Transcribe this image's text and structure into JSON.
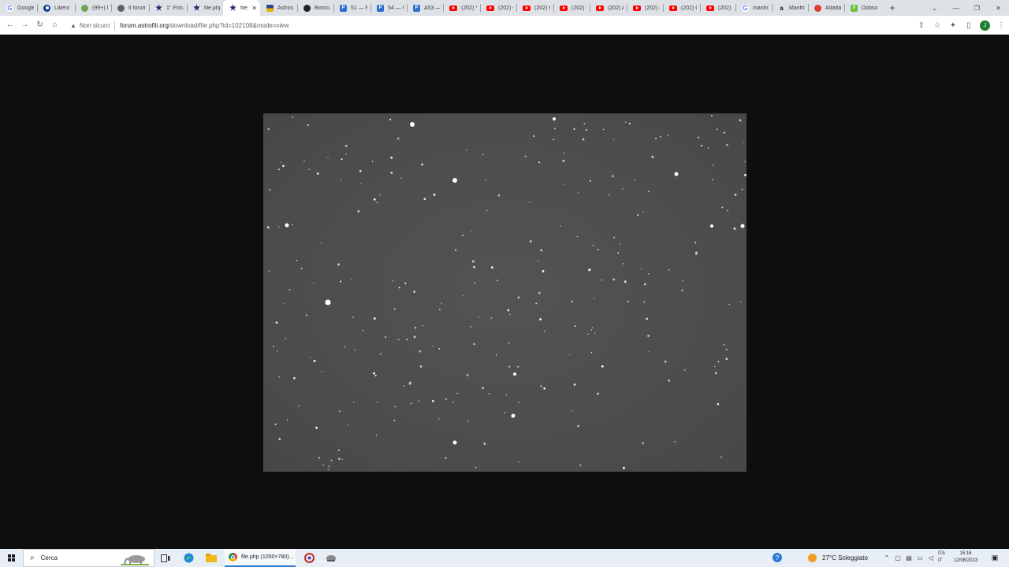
{
  "browser": {
    "tabs": [
      {
        "title": "Google",
        "icon": "google-icon",
        "active": false
      },
      {
        "title": "Libero",
        "icon": "libero-icon",
        "active": false
      },
      {
        "title": "(99+) M",
        "icon": "leaf-icon",
        "active": false
      },
      {
        "title": "Il forum",
        "icon": "globe-icon",
        "active": false
      },
      {
        "title": "1° Foru",
        "icon": "astrofili-star-icon",
        "active": false
      },
      {
        "title": "file.php",
        "icon": "astrofili-star-icon",
        "active": false
      },
      {
        "title": "file.",
        "icon": "astrofili-star-icon",
        "active": true
      },
      {
        "title": "Astros",
        "icon": "flag-icon",
        "active": false
      },
      {
        "title": "Binocu",
        "icon": "binocular-icon",
        "active": false
      },
      {
        "title": "51 — F",
        "icon": "p-icon",
        "active": false
      },
      {
        "title": "54 — F",
        "icon": "p-icon",
        "active": false
      },
      {
        "title": "A53 —",
        "icon": "p-icon",
        "active": false
      },
      {
        "title": "(202) Yi",
        "icon": "youtube-icon",
        "active": false
      },
      {
        "title": "(202) C",
        "icon": "youtube-icon",
        "active": false
      },
      {
        "title": "(202) H",
        "icon": "youtube-icon",
        "active": false
      },
      {
        "title": "(202) H",
        "icon": "youtube-icon",
        "active": false
      },
      {
        "title": "(202) A",
        "icon": "youtube-icon",
        "active": false
      },
      {
        "title": "(202) L",
        "icon": "youtube-icon",
        "active": false
      },
      {
        "title": "(202) C",
        "icon": "youtube-icon",
        "active": false
      },
      {
        "title": "(202) 2",
        "icon": "youtube-icon",
        "active": false
      },
      {
        "title": "manfro",
        "icon": "google-icon",
        "active": false
      },
      {
        "title": "Manfro",
        "icon": "amazon-icon",
        "active": false
      },
      {
        "title": "Adatta",
        "icon": "red-circle-icon",
        "active": false
      },
      {
        "title": "Dobso",
        "icon": "dobson-icon",
        "active": false
      }
    ],
    "close_glyph": "✕",
    "new_tab": "+",
    "window_controls": {
      "menu": "⌄",
      "minimize": "—",
      "restore": "❐",
      "close": "✕"
    },
    "toolbar": {
      "back": "←",
      "forward": "→",
      "reload": "↻",
      "home": "⌂",
      "security_icon": "warning-triangle-icon",
      "security_label": "Non sicuro",
      "url_host": "forum.astrofili.org",
      "url_path": "/download/file.php?id=102108&mode=view",
      "share": "⇪",
      "bookmark": "☆",
      "extensions": "✦",
      "side_panel": "▯",
      "profile_initial": "J",
      "menu": "⋮"
    }
  },
  "content": {
    "image_alt": "astrophotography star field"
  },
  "taskbar": {
    "search_placeholder": "Cerca",
    "chrome_label": "file.php (1050×780)...",
    "weather": "27°C  Soleggiato",
    "lang_line1": "ITA",
    "lang_line2": "IT",
    "time": "15:16",
    "date": "12/08/2023",
    "tray_up": "⌃",
    "notification": "▣"
  }
}
